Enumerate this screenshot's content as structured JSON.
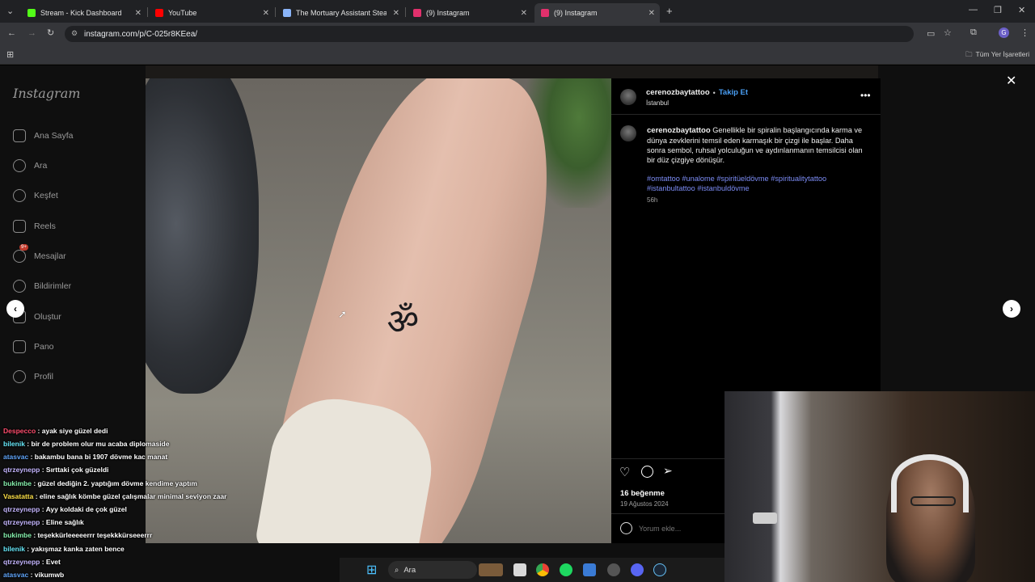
{
  "browser": {
    "tabs": [
      {
        "title": "Stream - Kick Dashboard",
        "favicon_color": "#53fc18"
      },
      {
        "title": "YouTube",
        "favicon_color": "#ff0000"
      },
      {
        "title": "The Mortuary Assistant Steam'i",
        "favicon_color": "#8ab4f8"
      },
      {
        "title": "(9) Instagram",
        "favicon_color": "#e1306c"
      },
      {
        "title": "(9) Instagram",
        "favicon_color": "#e1306c"
      }
    ],
    "active_tab_index": 4,
    "url": "instagram.com/p/C-025r8KEea/",
    "bookmarks_label": "Tüm Yer İşaretleri"
  },
  "instagram": {
    "logo": "Instagram",
    "nav": [
      {
        "label": "Ana Sayfa",
        "icon": "home-icon"
      },
      {
        "label": "Ara",
        "icon": "search-icon"
      },
      {
        "label": "Keşfet",
        "icon": "compass-icon"
      },
      {
        "label": "Reels",
        "icon": "reels-icon"
      },
      {
        "label": "Mesajlar",
        "icon": "messenger-icon",
        "badge": "9+"
      },
      {
        "label": "Bildirimler",
        "icon": "heart-icon"
      },
      {
        "label": "Oluştur",
        "icon": "plus-square-icon"
      },
      {
        "label": "Pano",
        "icon": "dashboard-icon"
      },
      {
        "label": "Profil",
        "icon": "profile-icon"
      }
    ],
    "post": {
      "username": "cerenozbaytattoo",
      "follow_label": "Takip Et",
      "location": "İstanbul",
      "tattoo_symbol": "ॐ",
      "caption": "Genellikle bir spiralin başlangıcında karma ve dünya zevklerini temsil eden karmaşık bir çizgi ile başlar. Daha sonra sembol, ruhsal yolculuğun ve aydınlanmanın temsilcisi olan bir düz çizgiye dönüşür.",
      "hashtags_line1": "#omtattoo #unalome #spiritüeldövme #spiritualitytattoo",
      "hashtags_line2": "#istanbultattoo #istanbuldövme",
      "caption_age": "56h",
      "likes": "16 beğenme",
      "date": "19 Ağustos 2024",
      "comment_placeholder": "Yorum ekle..."
    }
  },
  "chat": [
    {
      "user": "Despecco",
      "color": "#ff4d6d",
      "msg": "ayak siye güzel dedi"
    },
    {
      "user": "bilenik",
      "color": "#67e8f9",
      "msg": "bir de problem olur mu acaba diplomaside"
    },
    {
      "user": "atasvac",
      "color": "#60a5fa",
      "msg": "bakambu bana bi 1907 dövme kac manat"
    },
    {
      "user": "qtrzeynepp",
      "color": "#c4b5fd",
      "msg": "Sırttaki çok güzeldi"
    },
    {
      "user": "bukimbe",
      "color": "#86efac",
      "msg": "güzel dediğin 2. yaptığım dövme kendime yaptım"
    },
    {
      "user": "Vasatatta",
      "color": "#fde047",
      "msg": "eline sağlık kömbe güzel çalışmalar minimal seviyon zaar"
    },
    {
      "user": "qtrzeynepp",
      "color": "#c4b5fd",
      "msg": "Ayy koldaki de çok güzel"
    },
    {
      "user": "qtrzeynepp",
      "color": "#c4b5fd",
      "msg": "Eline sağlık"
    },
    {
      "user": "bukimbe",
      "color": "#86efac",
      "msg": "teşekkürleeeeerrr teşekkkürseeerrr"
    },
    {
      "user": "bilenik",
      "color": "#67e8f9",
      "msg": "yakışmaz kanka zaten bence"
    },
    {
      "user": "qtrzeynepp",
      "color": "#c4b5fd",
      "msg": "Evet"
    },
    {
      "user": "atasvac",
      "color": "#60a5fa",
      "msg": "vikumwb"
    }
  ],
  "taskbar": {
    "search_label": "Ara",
    "apps": [
      "chrome-icon",
      "spotify-icon",
      "store-icon",
      "steam-icon",
      "discord-icon"
    ]
  }
}
